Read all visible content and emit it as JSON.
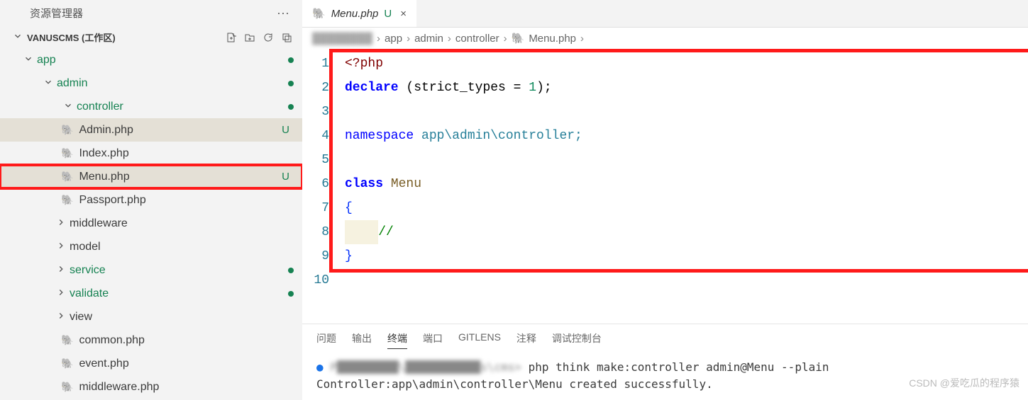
{
  "explorer": {
    "title": "资源管理器"
  },
  "workspace": {
    "title": "VANUSCMS (工作区)"
  },
  "tree": {
    "app": "app",
    "admin": "admin",
    "controller": "controller",
    "adminphp": "Admin.php",
    "indexphp": "Index.php",
    "menuphp": "Menu.php",
    "passportphp": "Passport.php",
    "middleware": "middleware",
    "model": "model",
    "service": "service",
    "validate": "validate",
    "view": "view",
    "commonphp": "common.php",
    "eventphp": "event.php",
    "middlewarephp": "middleware.php",
    "statusU": "U"
  },
  "tab": {
    "name": "Menu.php",
    "status": "U",
    "close": "×"
  },
  "breadcrumb": {
    "blur1": "████████",
    "app": "app",
    "admin": "admin",
    "controller": "controller",
    "file": "Menu.php",
    "sep": "›"
  },
  "code": {
    "l1_tag": "<?php",
    "l2": "declare (strict_types = 1);",
    "l4_ns": "namespace",
    "l4_path": " app\\admin\\controller;",
    "l6_class": "class",
    "l6_name": " Menu",
    "l7": "{",
    "l8_pad": "    ",
    "l8_com": "//",
    "l9": "}"
  },
  "lines": [
    "1",
    "2",
    "3",
    "4",
    "5",
    "6",
    "7",
    "8",
    "9",
    "10"
  ],
  "terminalTabs": {
    "problems": "问题",
    "output": "输出",
    "terminal": "终端",
    "ports": "端口",
    "gitlens": "GITLENS",
    "comments": "注释",
    "debug": "调试控制台"
  },
  "terminal": {
    "line1_blur": "P█████████\\███████████s\\cms>",
    "line1_cmd": " php think make:controller admin@Menu --plain",
    "line2": "Controller:app\\admin\\controller\\Menu created successfully."
  },
  "watermark": "CSDN @爱吃瓜的程序猿"
}
